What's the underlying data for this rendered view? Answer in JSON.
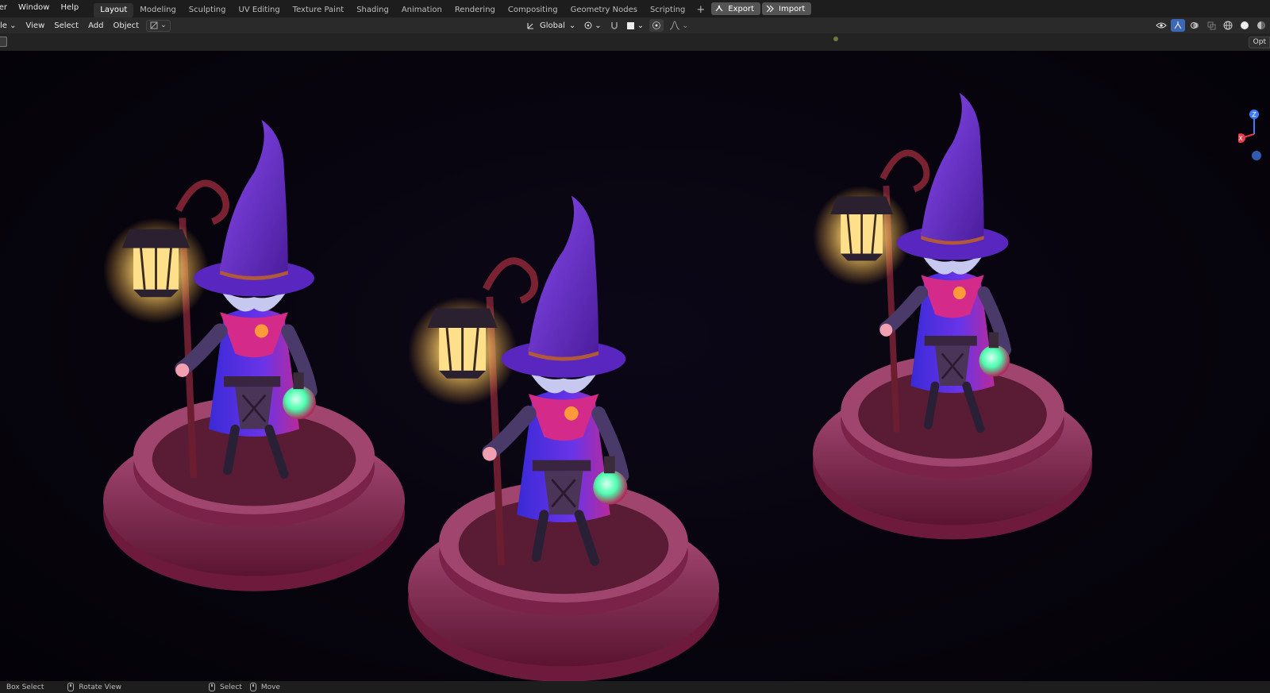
{
  "topbar": {
    "menus": [
      "ler",
      "Window",
      "Help"
    ],
    "workspaces": [
      "Layout",
      "Modeling",
      "Sculpting",
      "UV Editing",
      "Texture Paint",
      "Shading",
      "Animation",
      "Rendering",
      "Compositing",
      "Geometry Nodes",
      "Scripting"
    ],
    "active_workspace": "Layout",
    "add_tab": "+",
    "export_label": "Export",
    "import_label": "Import"
  },
  "header": {
    "mode_label": "le",
    "menus": [
      "View",
      "Select",
      "Add",
      "Object"
    ],
    "transform_orientation": "Global",
    "options_label": "Opt"
  },
  "status": {
    "box_select": "Box Select",
    "rotate_view": "Rotate View",
    "select": "Select",
    "move": "Move"
  },
  "gizmo": {
    "z_label": "Z",
    "x_label": "X"
  },
  "colors": {
    "accent": "#3d68b6",
    "viewport_bg": "#05030a",
    "hat": "#6a2bd6",
    "robe": "#5a2bd8",
    "scarf": "#d42a8a",
    "base": "#8a2248",
    "lantern_glow": "#ffd66b",
    "potion": "#4cffb0"
  }
}
